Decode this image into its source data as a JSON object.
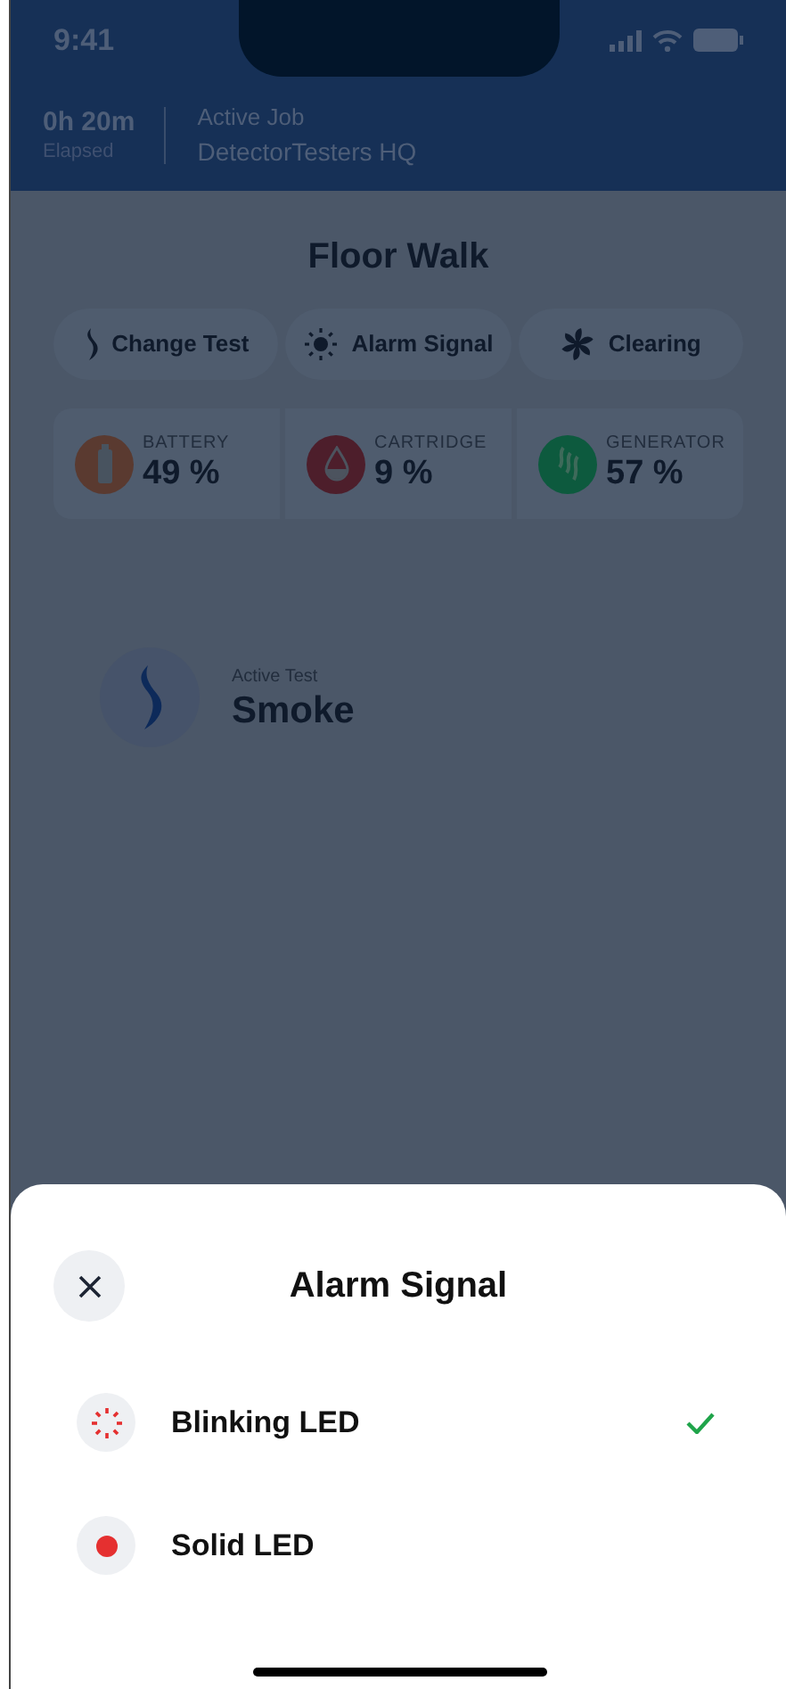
{
  "status_bar": {
    "time": "9:41"
  },
  "header": {
    "elapsed": "0h 20m",
    "elapsed_label": "Elapsed",
    "job_label": "Active Job",
    "job_name": "DetectorTesters HQ"
  },
  "title": "Floor Walk",
  "actions": [
    {
      "kind": "smoke",
      "label": "Change Test"
    },
    {
      "kind": "sun",
      "label": "Alarm Signal"
    },
    {
      "kind": "fan",
      "label": "Clearing"
    }
  ],
  "stats": [
    {
      "kind": "battery",
      "label": "BATTERY",
      "value": "49 %",
      "color": "#5a3a30"
    },
    {
      "kind": "drop",
      "label": "CARTRIDGE",
      "value": "9 %",
      "color": "#4d1e2b"
    },
    {
      "kind": "smoke",
      "label": "GENERATOR",
      "value": "57 %",
      "color": "#0d5a3e"
    }
  ],
  "active_test": {
    "label": "Active Test",
    "name": "Smoke"
  },
  "sheet": {
    "title": "Alarm Signal",
    "options": [
      {
        "kind": "blinking",
        "label": "Blinking LED",
        "selected": true
      },
      {
        "kind": "solid",
        "label": "Solid LED",
        "selected": false
      }
    ]
  }
}
